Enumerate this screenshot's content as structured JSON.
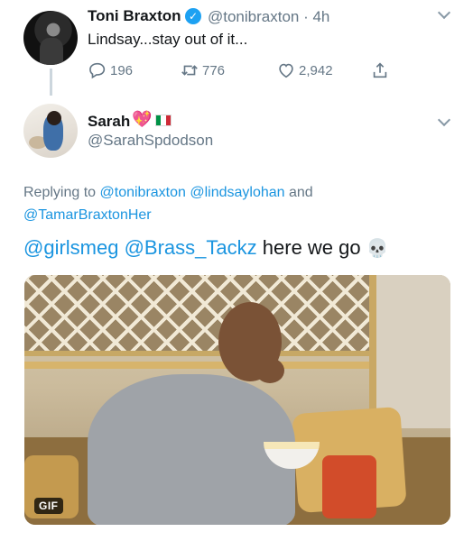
{
  "tweet1": {
    "name": "Toni Braxton",
    "handle_time": "@tonibraxton · 4h",
    "text": "Lindsay...stay out of it...",
    "actions": {
      "reply_count": "196",
      "retweet_count": "776",
      "like_count": "2,942"
    }
  },
  "tweet2": {
    "name": "Sarah",
    "handle": "@SarahSpdodson",
    "replying": {
      "prefix": "Replying to ",
      "mention1": "@tonibraxton",
      "mention2": "@lindsaylohan",
      "and": " and",
      "mention3": "@TamarBraxtonHer"
    },
    "text": {
      "mention1": "@girlsmeg",
      "mention2": "@Brass_Tackz",
      "rest": "here we go",
      "emoji": "💀"
    },
    "media": {
      "badge": "GIF"
    }
  },
  "icons": {
    "reply": "reply-icon",
    "retweet": "retweet-icon",
    "like": "like-icon",
    "share": "share-icon",
    "verified": "verified-badge-icon",
    "menu": "chevron-down-icon"
  },
  "colors": {
    "link": "#1b95e0",
    "secondary_text": "#657786",
    "verified": "#1da1f2"
  }
}
